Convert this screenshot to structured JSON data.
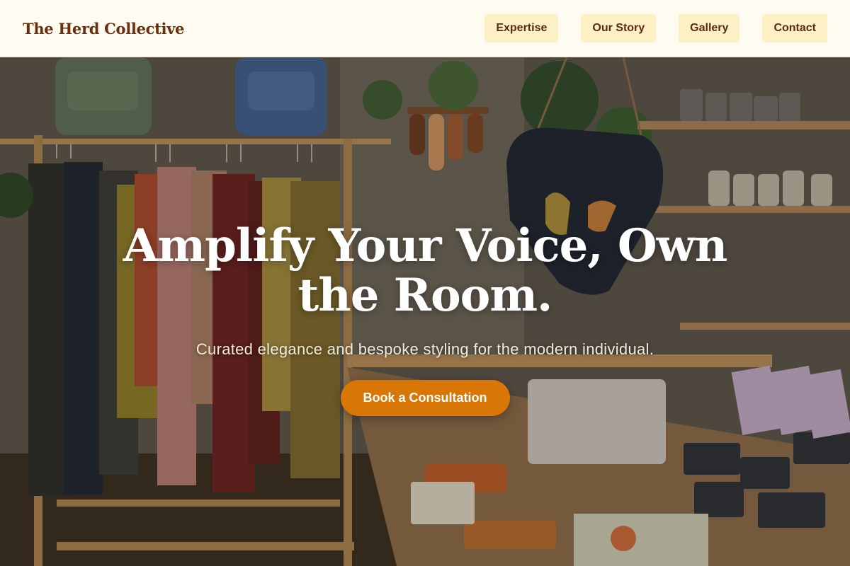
{
  "header": {
    "brand": "The Herd Collective",
    "nav": [
      {
        "label": "Expertise"
      },
      {
        "label": "Our Story"
      },
      {
        "label": "Gallery"
      },
      {
        "label": "Contact"
      }
    ]
  },
  "hero": {
    "title": "Amplify Your Voice, Own the Room.",
    "subtitle": "Curated elegance and bespoke styling for the modern individual.",
    "cta_label": "Book a Consultation"
  },
  "colors": {
    "header_bg": "#fefcf1",
    "brand": "#6b2e0e",
    "nav_bg": "#fdf0c4",
    "accent": "#d97706"
  }
}
